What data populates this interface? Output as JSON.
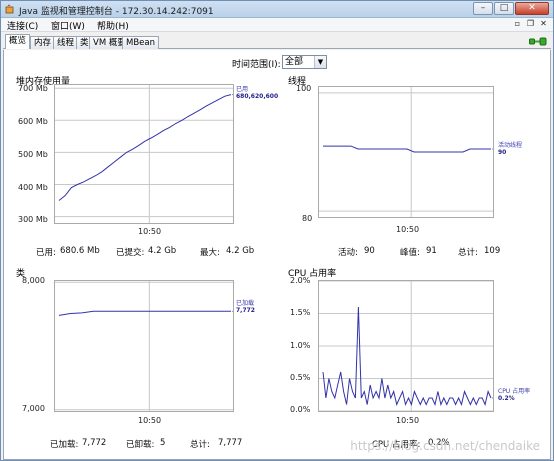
{
  "window": {
    "title": "Java 监视和管理控制台 - 172.30.14.242:7091"
  },
  "menu": [
    {
      "label": "连接(C)"
    },
    {
      "label": "窗口(W)"
    },
    {
      "label": "帮助(H)"
    }
  ],
  "tabs": [
    {
      "label": "概览",
      "active": true
    },
    {
      "label": "内存"
    },
    {
      "label": "线程"
    },
    {
      "label": "类"
    },
    {
      "label": "VM 概要"
    },
    {
      "label": "MBean"
    }
  ],
  "time_range": {
    "label": "时间范围(I):",
    "value": "全部"
  },
  "panels": {
    "heap": {
      "title": "堆内存使用量",
      "yticks": [
        "700 Mb",
        "600 Mb",
        "500 Mb",
        "400 Mb",
        "300 Mb"
      ],
      "xtick": "10:50",
      "legend_label": "已用",
      "legend_value": "680,620,600",
      "stats": [
        {
          "label": "已用:",
          "value": "680.6 Mb"
        },
        {
          "label": "已提交:",
          "value": "4.2 Gb"
        },
        {
          "label": "最大:",
          "value": "4.2 Gb"
        }
      ]
    },
    "threads": {
      "title": "线程",
      "yticks": [
        "100",
        "80"
      ],
      "xtick": "10:50",
      "legend_label": "活动线程",
      "legend_value": "90",
      "stats": [
        {
          "label": "活动:",
          "value": "90"
        },
        {
          "label": "峰值:",
          "value": "91"
        },
        {
          "label": "总计:",
          "value": "109"
        }
      ]
    },
    "classes": {
      "title": "类",
      "yticks": [
        "8,000",
        "7,000"
      ],
      "xtick": "10:50",
      "legend_label": "已加载",
      "legend_value": "7,772",
      "stats": [
        {
          "label": "已加载:",
          "value": "7,772"
        },
        {
          "label": "已卸载:",
          "value": "5"
        },
        {
          "label": "总计:",
          "value": "7,777"
        }
      ]
    },
    "cpu": {
      "title": "CPU 占用率",
      "yticks": [
        "2.0%",
        "1.5%",
        "1.0%",
        "0.5%",
        "0.0%"
      ],
      "xtick": "10:50",
      "legend_label": "CPU 占用率",
      "legend_value": "0.2%",
      "stats": [
        {
          "label": "CPU 占用率:",
          "value": "0.2%"
        }
      ]
    }
  },
  "colors": {
    "series": "#3333aa",
    "grid": "#c8c8c8",
    "titlebar": "#c4d8ee"
  },
  "watermark": "https://blog.csdn.net/chendaike",
  "chart_data": [
    {
      "type": "line",
      "title": "堆内存使用量",
      "ylabel": "Mb",
      "ylim": [
        280,
        710
      ],
      "series": [
        {
          "name": "已用",
          "values": [
            350,
            365,
            390,
            400,
            408,
            418,
            428,
            440,
            455,
            470,
            485,
            500,
            510,
            522,
            535,
            545,
            556,
            568,
            578,
            590,
            600,
            612,
            622,
            633,
            645,
            655,
            665,
            675,
            680
          ]
        }
      ]
    },
    {
      "type": "line",
      "title": "线程",
      "ylim": [
        79,
        101
      ],
      "series": [
        {
          "name": "活动线程",
          "values": [
            91,
            91,
            91,
            91,
            91,
            90.5,
            90.5,
            90.5,
            90.5,
            90.5,
            90.5,
            90.5,
            90.5,
            90,
            90,
            90,
            90,
            90,
            90,
            90,
            90,
            90.5,
            90.5,
            90.5,
            90.5
          ]
        }
      ]
    },
    {
      "type": "line",
      "title": "类",
      "ylim": [
        6990,
        8010
      ],
      "series": [
        {
          "name": "已加载",
          "values": [
            7740,
            7755,
            7760,
            7772,
            7772,
            7772,
            7772,
            7772,
            7772,
            7772,
            7772,
            7772,
            7772,
            7772,
            7772,
            7772
          ]
        }
      ]
    },
    {
      "type": "line",
      "title": "CPU 占用率",
      "ylim": [
        0,
        2.0
      ],
      "series": [
        {
          "name": "CPU 占用率",
          "values": [
            0.6,
            0.2,
            0.5,
            0.3,
            0.2,
            0.4,
            0.6,
            0.3,
            0.1,
            0.5,
            0.3,
            0.2,
            1.6,
            0.2,
            0.3,
            0.1,
            0.4,
            0.2,
            0.3,
            0.2,
            0.5,
            0.2,
            0.4,
            0.2,
            0.3,
            0.1,
            0.2,
            0.3,
            0.1,
            0.2,
            0.1,
            0.3,
            0.2,
            0.1,
            0.2,
            0.1,
            0.2,
            0.2,
            0.1,
            0.3,
            0.1,
            0.2,
            0.1,
            0.2,
            0.2,
            0.1,
            0.2,
            0.1,
            0.3,
            0.2,
            0.1,
            0.2,
            0.1,
            0.2,
            0.2,
            0.1,
            0.3,
            0.2
          ]
        }
      ]
    }
  ]
}
